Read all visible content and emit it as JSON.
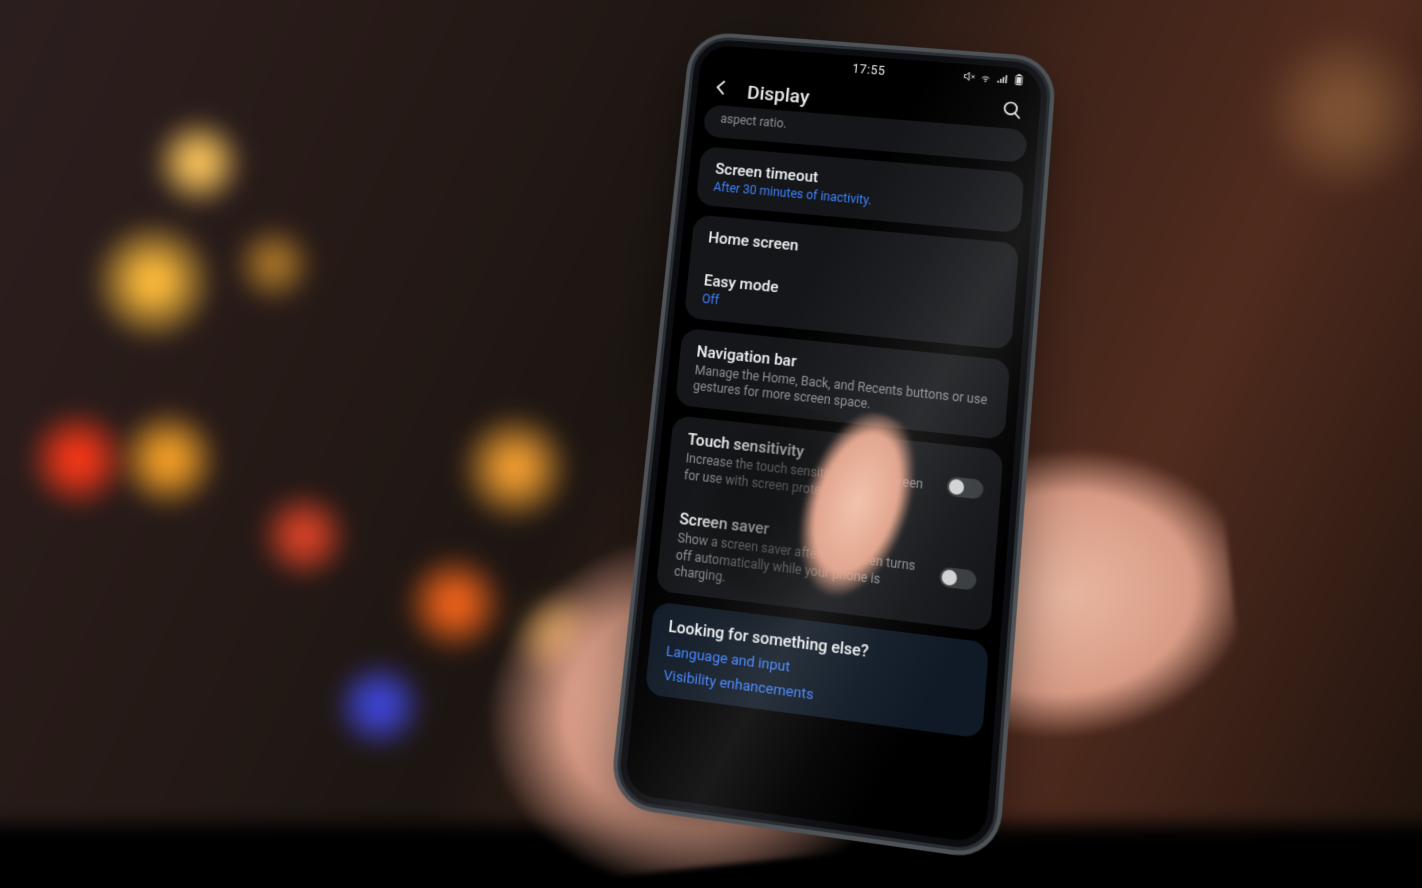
{
  "status_bar": {
    "time": "17:55"
  },
  "header": {
    "title": "Display"
  },
  "partial_row": {
    "sub": "aspect ratio."
  },
  "rows": {
    "screen_timeout": {
      "label": "Screen timeout",
      "sub": "After 30 minutes of inactivity."
    },
    "home_screen": {
      "label": "Home screen"
    },
    "easy_mode": {
      "label": "Easy mode",
      "sub": "Off"
    },
    "navigation_bar": {
      "label": "Navigation bar",
      "sub": "Manage the Home, Back, and Recents buttons or use gestures for more screen space."
    },
    "touch_sensitivity": {
      "label": "Touch sensitivity",
      "sub": "Increase the touch sensitivity of the screen for use with screen protectors."
    },
    "screen_saver": {
      "label": "Screen saver",
      "sub": "Show a screen saver after the screen turns off automatically while your phone is charging."
    }
  },
  "footer": {
    "title": "Looking for something else?",
    "links": {
      "language_input": "Language and input",
      "visibility": "Visibility enhancements"
    }
  }
}
